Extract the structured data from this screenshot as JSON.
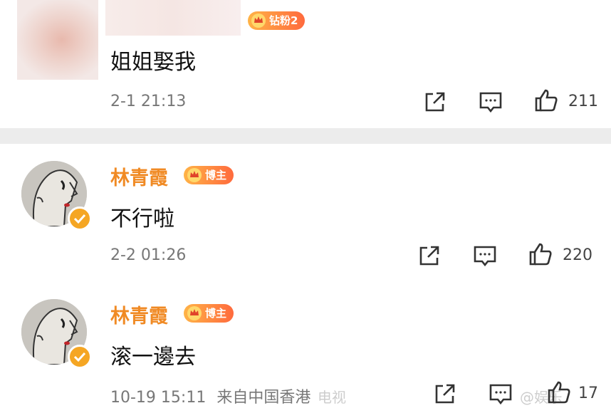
{
  "comments": [
    {
      "text": "姐姐娶我",
      "badge": "钻粉2",
      "time": "2-1 21:13",
      "likes": "211"
    },
    {
      "name": "林青霞",
      "badge": "博主",
      "text": "不行啦",
      "time": "2-2 01:26",
      "likes": "220"
    },
    {
      "name": "林青霞",
      "badge": "博主",
      "text": "滚一邊去",
      "time": "10-19 15:11",
      "location": "来自中国香港",
      "likes": "17"
    }
  ],
  "watermark": {
    "left": "电视",
    "right": "@娱乐"
  },
  "colors": {
    "name": "#f08a24",
    "badge_start": "#ffb347",
    "badge_end": "#ff6a3d",
    "verified": "#f5a623"
  }
}
